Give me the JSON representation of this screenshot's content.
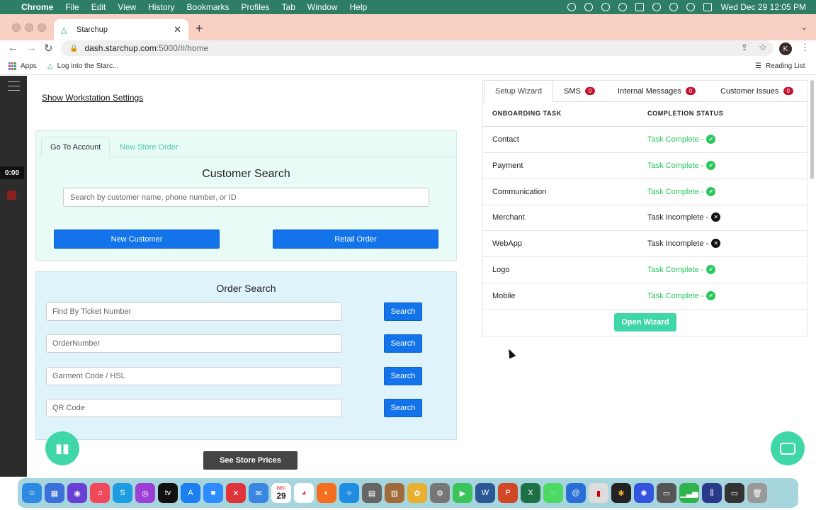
{
  "menubar": {
    "app": "Chrome",
    "items": [
      "File",
      "Edit",
      "View",
      "History",
      "Bookmarks",
      "Profiles",
      "Tab",
      "Window",
      "Help"
    ],
    "datetime": "Wed Dec 29  12:05 PM"
  },
  "browser": {
    "tab_title": "Starchup",
    "url_host": "dash.starchup.com",
    "url_path": ":5000/#/home",
    "avatar_letter": "K",
    "bookmarks": {
      "apps": "Apps",
      "login": "Log into the Starc...",
      "reading_list": "Reading List"
    }
  },
  "sidebar": {
    "timer": "0:00"
  },
  "page": {
    "show_workstation": "Show Workstation Settings",
    "customer": {
      "tabs": [
        "Go To Account",
        "New Store Order"
      ],
      "title": "Customer Search",
      "search_placeholder": "Search by customer name, phone number, or ID",
      "new_customer": "New Customer",
      "retail_order": "Retail Order"
    },
    "order": {
      "title": "Order Search",
      "fields": [
        {
          "placeholder": "Find By Ticket Number",
          "button": "Search"
        },
        {
          "placeholder": "OrderNumber",
          "button": "Search"
        },
        {
          "placeholder": "Garment Code / HSL",
          "button": "Search"
        },
        {
          "placeholder": "QR Code",
          "button": "Search"
        }
      ]
    },
    "store_prices": "See Store Prices"
  },
  "panel": {
    "tabs": {
      "setup": "Setup Wizard",
      "sms": "SMS",
      "sms_count": "0",
      "internal": "Internal Messages",
      "internal_count": "0",
      "issues": "Customer Issues",
      "issues_count": "0"
    },
    "headers": {
      "task": "ONBOARDING TASK",
      "status": "COMPLETION STATUS"
    },
    "tasks": [
      {
        "name": "Contact",
        "status": "Task Complete -",
        "complete": true
      },
      {
        "name": "Payment",
        "status": "Task Complete -",
        "complete": true
      },
      {
        "name": "Communication",
        "status": "Task Complete -",
        "complete": true
      },
      {
        "name": "Merchant",
        "status": "Task Incomplete -",
        "complete": false
      },
      {
        "name": "WebApp",
        "status": "Task Incomplete -",
        "complete": false
      },
      {
        "name": "Logo",
        "status": "Task Complete -",
        "complete": true
      },
      {
        "name": "Mobile",
        "status": "Task Complete -",
        "complete": true
      }
    ],
    "open_wizard": "Open Wizard"
  },
  "colors": {
    "menubar": "#2e7d66",
    "tabstrip": "#f8d0c4",
    "primary_blue": "#1273eb",
    "teal": "#3fd6a8",
    "complete_green": "#2bc85e",
    "badge_red": "#c8102e"
  },
  "dock": {
    "calendar_day": "29",
    "calendar_month": "DEC"
  }
}
